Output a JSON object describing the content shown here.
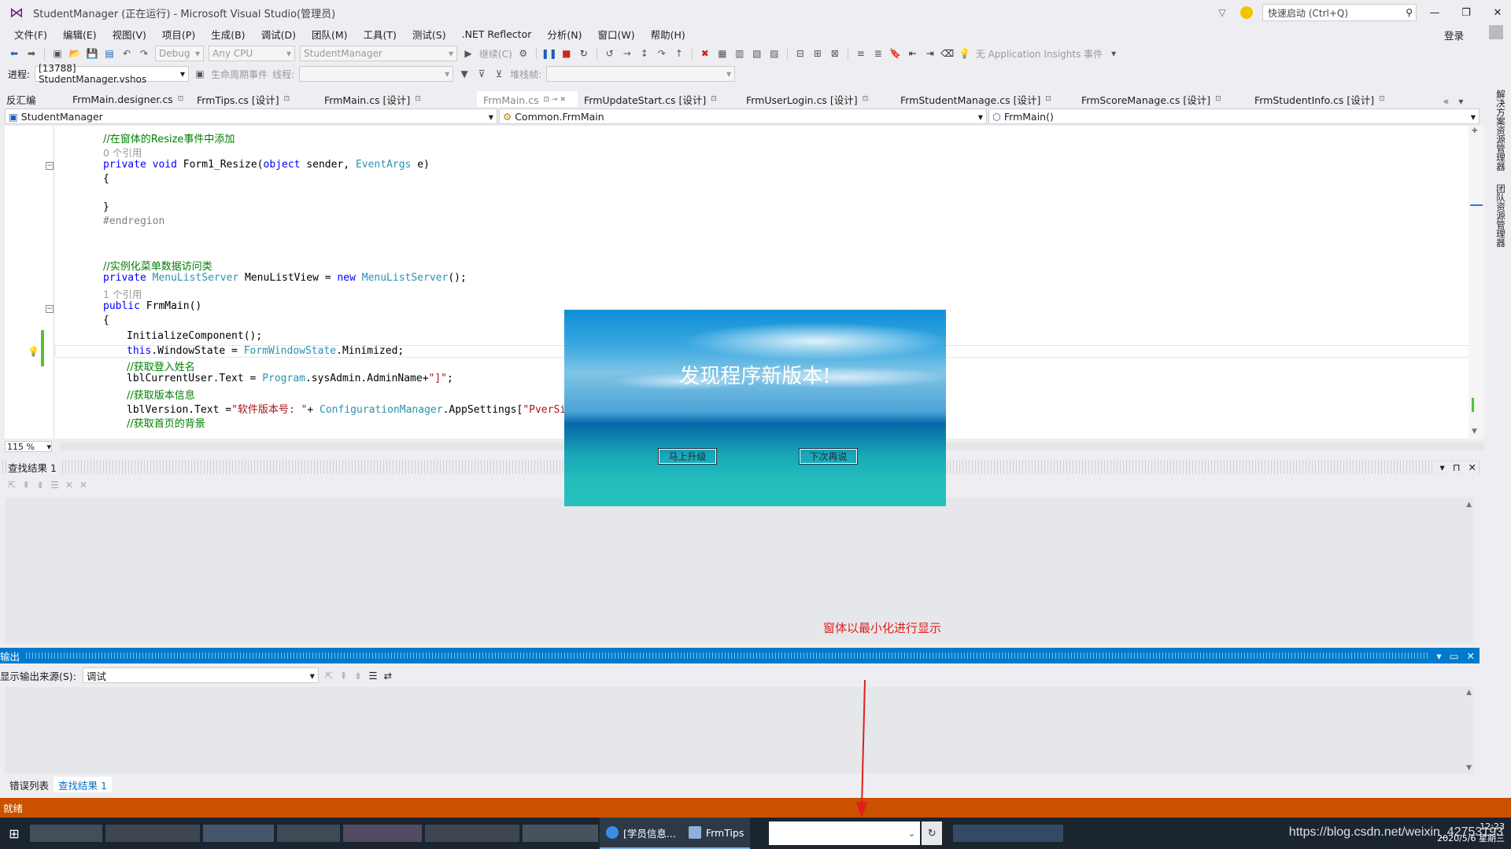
{
  "window": {
    "title": "StudentManager (正在运行) - Microsoft Visual Studio(管理员)",
    "quick_launch_placeholder": "快速启动 (Ctrl+Q)",
    "login": "登录"
  },
  "menu": [
    "文件(F)",
    "编辑(E)",
    "视图(V)",
    "项目(P)",
    "生成(B)",
    "调试(D)",
    "团队(M)",
    "工具(T)",
    "测试(S)",
    ".NET Reflector",
    "分析(N)",
    "窗口(W)",
    "帮助(H)"
  ],
  "toolbar1": {
    "config": "Debug",
    "platform": "Any CPU",
    "startup_project": "StudentManager",
    "continue": "继续(C)",
    "app_insights": "无 Application Insights 事件"
  },
  "toolbar2": {
    "process_label": "进程:",
    "process": "[13788] StudentManager.vshos",
    "lifecycle": "生命周期事件",
    "thread_label": "线程:",
    "stack_label": "堆栈帧:"
  },
  "tabs": [
    {
      "label": "反汇编",
      "pin": ""
    },
    {
      "label": "FrmMain.designer.cs",
      "pin": "⊡"
    },
    {
      "label": "FrmTips.cs [设计]",
      "pin": "⊡"
    },
    {
      "label": "FrmMain.cs [设计]",
      "pin": "⊡"
    },
    {
      "label": "FrmMain.cs",
      "pin": "⊡ ⊸ ✕"
    },
    {
      "label": "FrmUpdateStart.cs [设计]",
      "pin": "⊡"
    },
    {
      "label": "FrmUserLogin.cs [设计]",
      "pin": "⊡"
    },
    {
      "label": "FrmStudentManage.cs [设计]",
      "pin": "⊡"
    },
    {
      "label": "FrmScoreManage.cs [设计]",
      "pin": "⊡"
    },
    {
      "label": "FrmStudentInfo.cs [设计]",
      "pin": "⊡"
    }
  ],
  "navbar": {
    "project": "StudentManager",
    "class": "Common.FrmMain",
    "member": "FrmMain()"
  },
  "code": {
    "l1": "//在窗体的Resize事件中添加",
    "l2_ref": "0 个引用",
    "l3_a": "private",
    "l3_b": "void",
    "l3_c": " Form1_Resize(",
    "l3_d": "object",
    "l3_e": " sender, ",
    "l3_f": "EventArgs",
    "l3_g": " e)",
    "l4": "{",
    "l5": "}",
    "l6": "#endregion",
    "l7": "//实例化菜单数据访问类",
    "l8_a": "private",
    "l8_b": "MenuListServer",
    "l8_c": " MenuListView = ",
    "l8_d": "new",
    "l8_e": "MenuListServer",
    "l8_f": "();",
    "l9_ref": "1 个引用",
    "l10_a": "public",
    "l10_b": " FrmMain()",
    "l11": "{",
    "l12": "InitializeComponent();",
    "l13_a": "this",
    "l13_b": ".WindowState = ",
    "l13_c": "FormWindowState",
    "l13_d": ".Minimized;",
    "l14": "//获取登入姓名",
    "l15_a": "lblCurrentUser.Text = ",
    "l15_b": "Program",
    "l15_c": ".sysAdmin.AdminName+",
    "l15_d": "\"]\"",
    "l15_e": ";",
    "l16": "//获取版本信息",
    "l17_a": "lblVersion.Text =",
    "l17_b": "\"软件版本号: \"",
    "l17_c": "+ ",
    "l17_d": "ConfigurationManager",
    "l17_e": ".AppSettings[",
    "l17_f": "\"PverSion",
    "l18": "//获取首页的背景"
  },
  "zoom": "115 %",
  "find_panel": {
    "title": "查找结果 1"
  },
  "output_panel": {
    "title": "输出",
    "source_label": "显示输出来源(S):",
    "source_value": "调试"
  },
  "bottom_tabs": [
    "错误列表",
    "查找结果 1"
  ],
  "status": "就绪",
  "right_sidebar": [
    "解决方案资源管理器",
    "团队资源管理器"
  ],
  "popup": {
    "headline": "发现程序新版本!",
    "upgrade_button": "马上升级",
    "later_button": "下次再说"
  },
  "annotation": "窗体以最小化进行显示",
  "taskbar": {
    "app1": "[学员信息...",
    "app2": "FrmTips",
    "clock_time": "12:23",
    "clock_date": "2020/5/6 星期三",
    "watermark": "https://blog.csdn.net/weixin_42753193"
  },
  "colors": {
    "accent": "#007acc",
    "status_bar": "#ca5100",
    "annotation": "#e0201b"
  }
}
